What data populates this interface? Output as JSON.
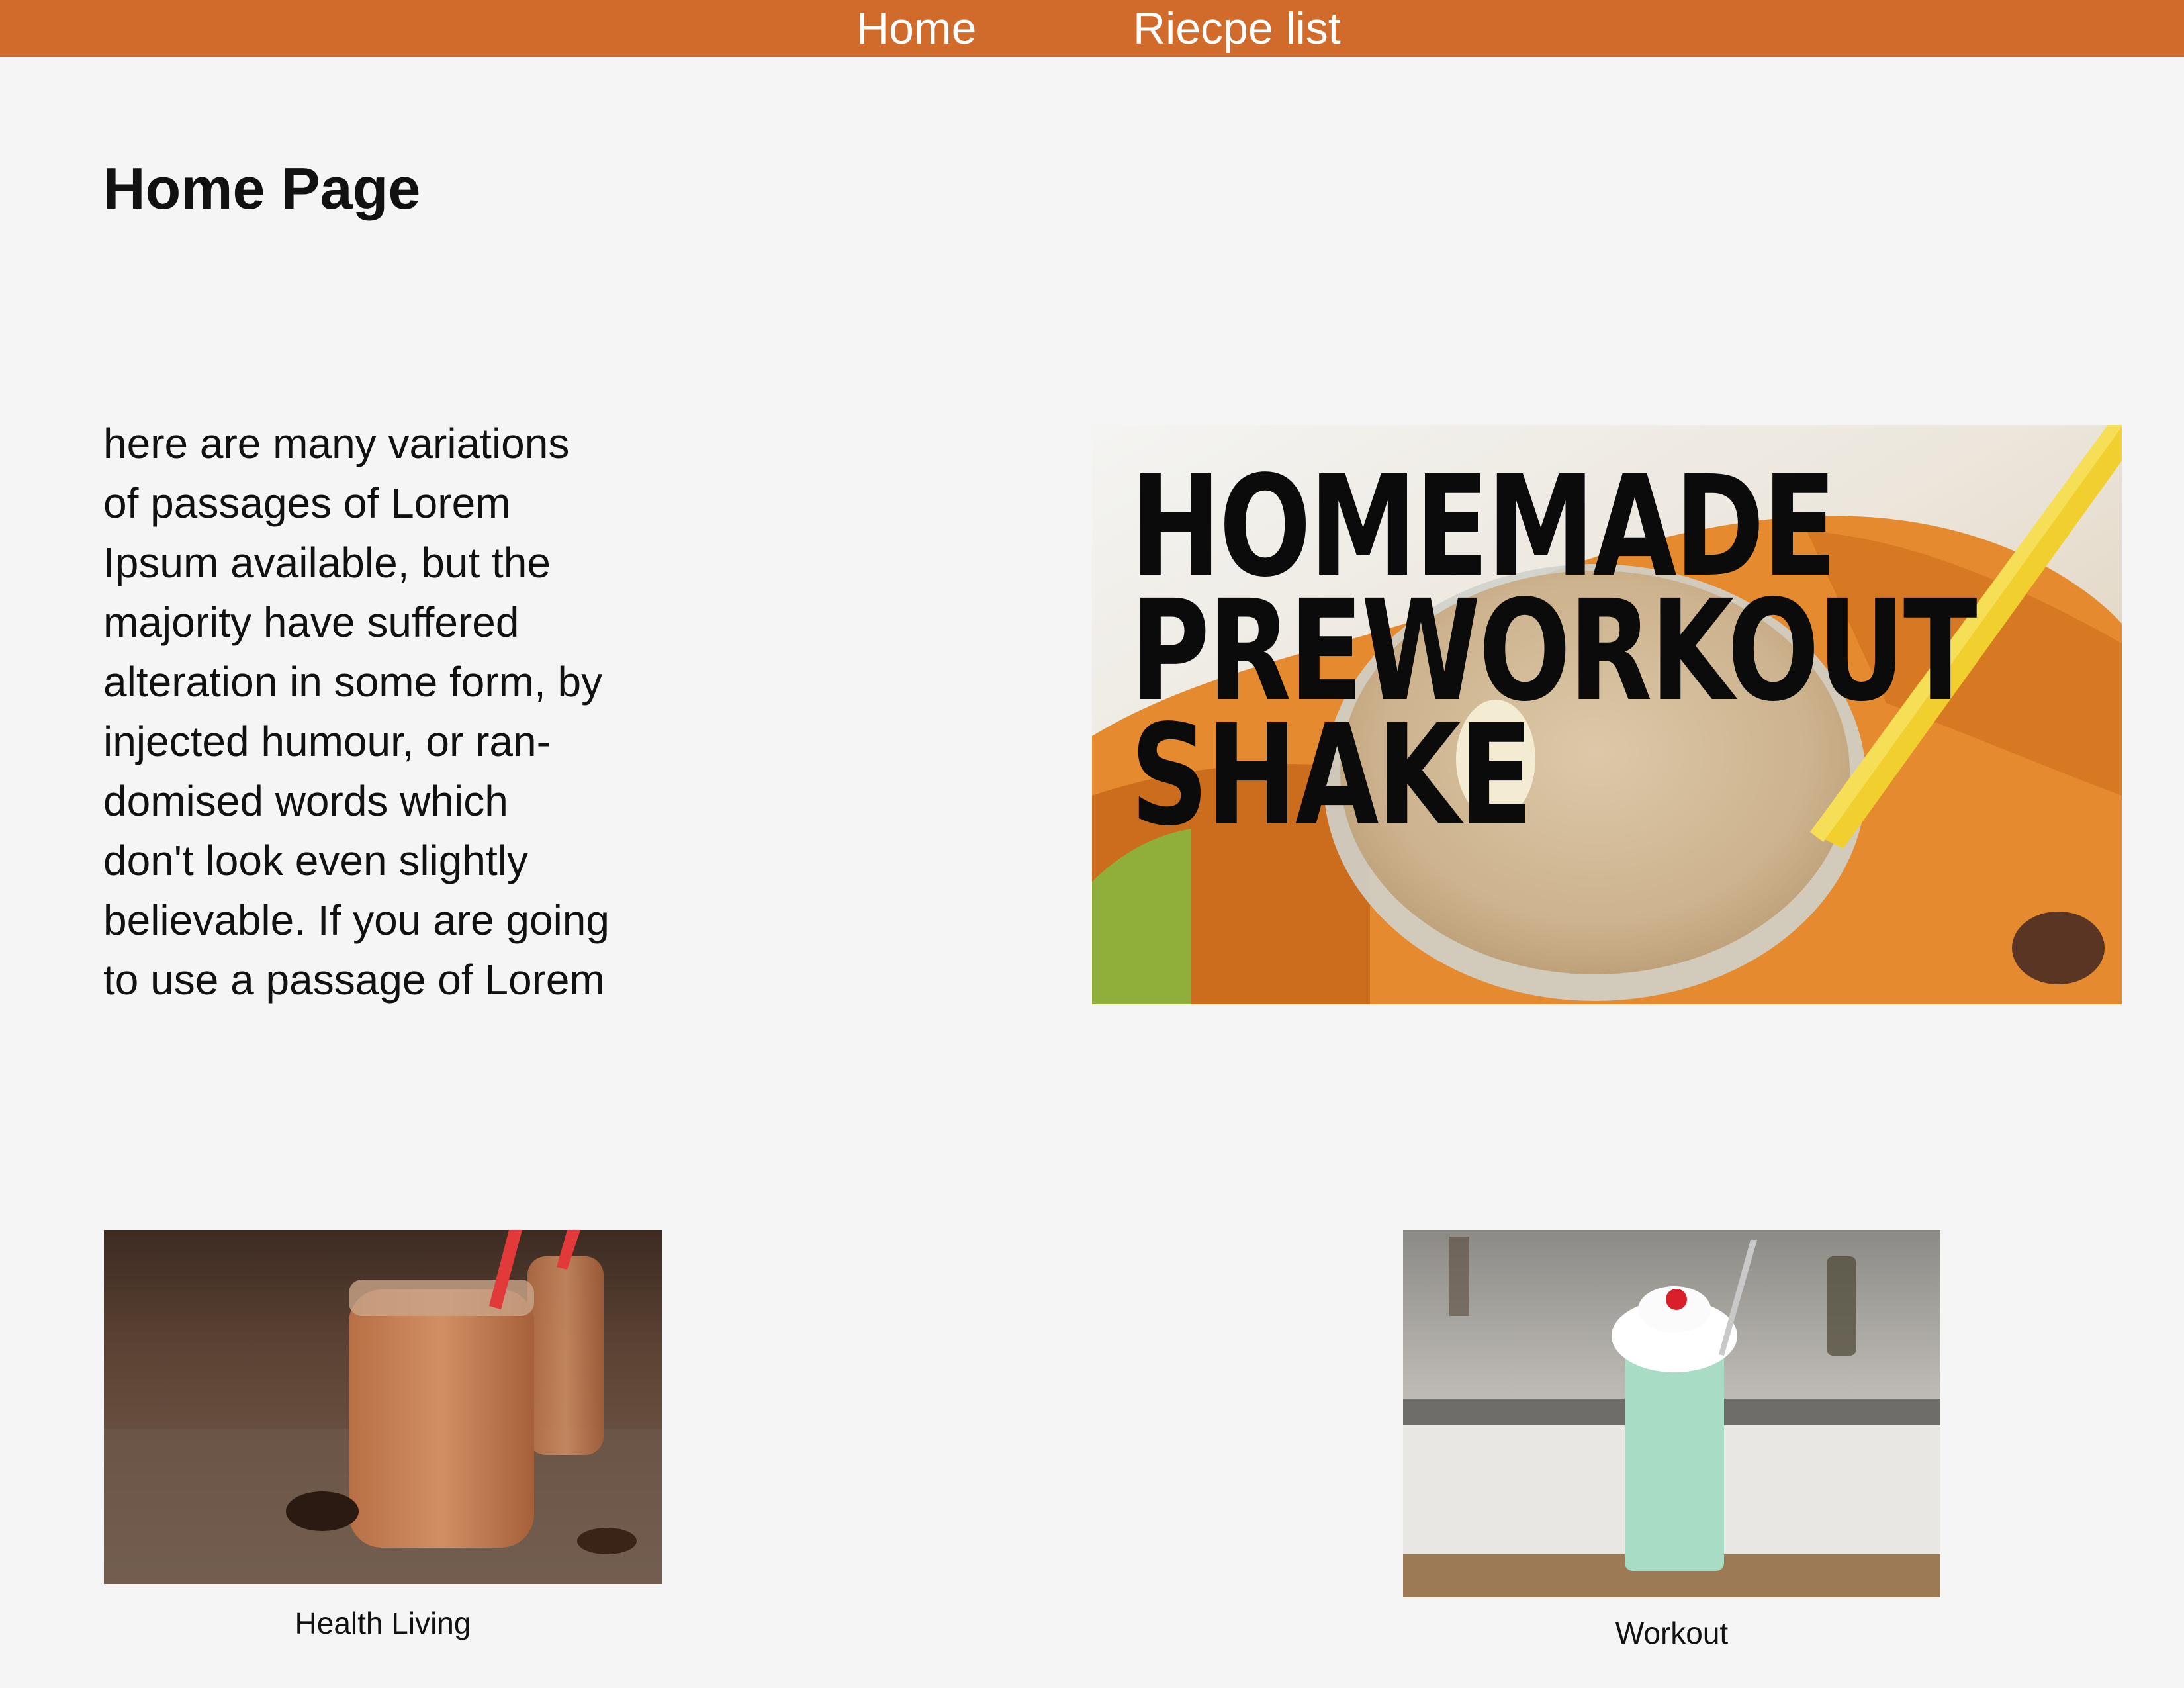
{
  "nav": {
    "home_label": "Home",
    "recipes_label": "Riecpe list"
  },
  "page": {
    "title": "Home Page",
    "intro_lines": [
      "here are many variations",
      "of passages of Lorem",
      "Ipsum available, but the",
      "majority have suffered",
      "alteration in some form, by",
      "injected humour, or ran-",
      "domised words which",
      "don't look even slightly",
      "believable. If you are going",
      "to use a passage of Lorem"
    ]
  },
  "hero": {
    "lines": [
      "HOMEMADE",
      "PREWORKOUT",
      "SHAKE"
    ]
  },
  "cards": [
    {
      "caption": "Health Living"
    },
    {
      "caption": "Workout"
    }
  ],
  "colors": {
    "nav_bg": "#d06b2c",
    "page_bg": "#f5f5f5",
    "text": "#111111"
  }
}
